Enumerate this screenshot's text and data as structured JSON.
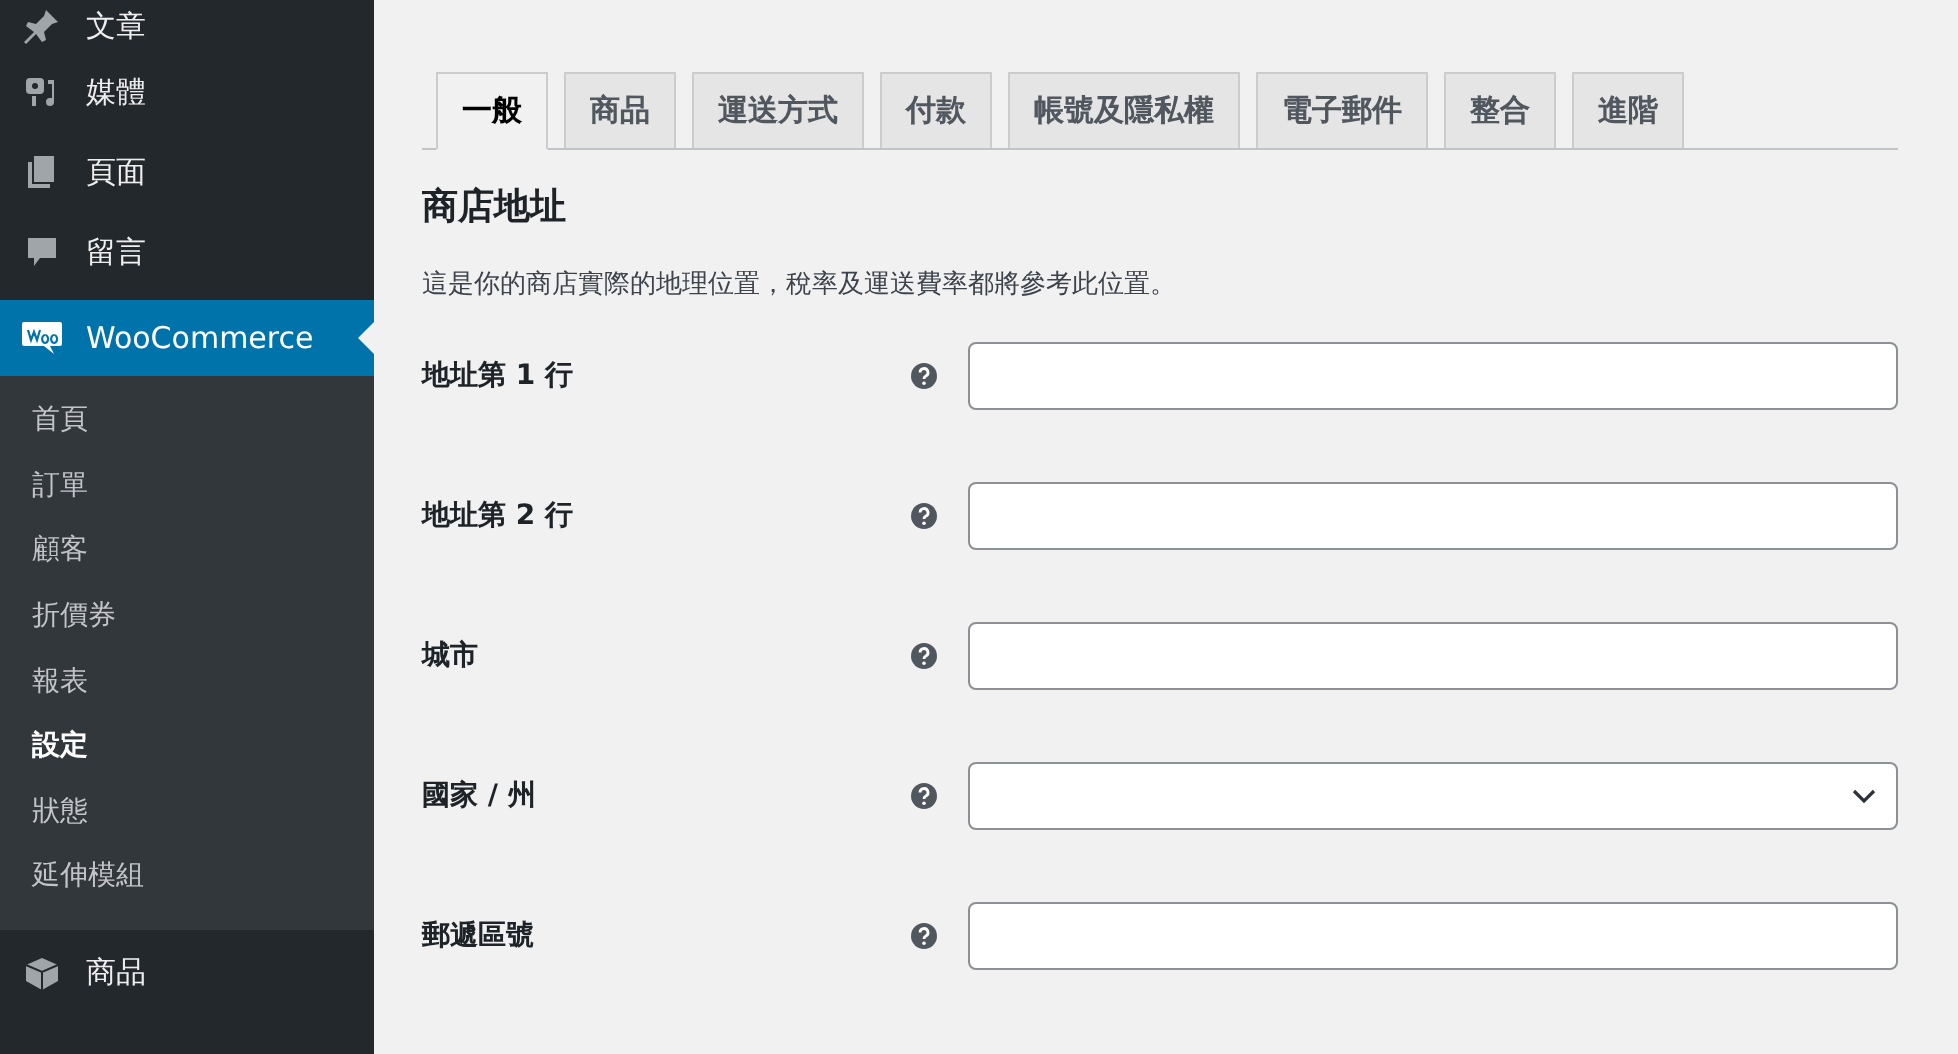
{
  "sidebar": {
    "items": [
      {
        "label": "文章"
      },
      {
        "label": "媒體"
      },
      {
        "label": "頁面"
      },
      {
        "label": "留言"
      }
    ],
    "active": {
      "label": "WooCommerce"
    },
    "submenu": [
      {
        "label": "首頁",
        "selected": false
      },
      {
        "label": "訂單",
        "selected": false
      },
      {
        "label": "顧客",
        "selected": false
      },
      {
        "label": "折價券",
        "selected": false
      },
      {
        "label": "報表",
        "selected": false
      },
      {
        "label": "設定",
        "selected": true
      },
      {
        "label": "狀態",
        "selected": false
      },
      {
        "label": "延伸模組",
        "selected": false
      }
    ],
    "after": [
      {
        "label": "商品"
      }
    ]
  },
  "tabs": [
    {
      "label": "一般",
      "selected": true
    },
    {
      "label": "商品",
      "selected": false
    },
    {
      "label": "運送方式",
      "selected": false
    },
    {
      "label": "付款",
      "selected": false
    },
    {
      "label": "帳號及隱私權",
      "selected": false
    },
    {
      "label": "電子郵件",
      "selected": false
    },
    {
      "label": "整合",
      "selected": false
    },
    {
      "label": "進階",
      "selected": false
    }
  ],
  "section": {
    "title": "商店地址",
    "description": "這是你的商店實際的地理位置，稅率及運送費率都將參考此位置。"
  },
  "fields": [
    {
      "label": "地址第 1 行",
      "kind": "text"
    },
    {
      "label": "地址第 2 行",
      "kind": "text"
    },
    {
      "label": "城市",
      "kind": "text"
    },
    {
      "label": "國家 / 州",
      "kind": "select"
    },
    {
      "label": "郵遞區號",
      "kind": "text"
    }
  ]
}
